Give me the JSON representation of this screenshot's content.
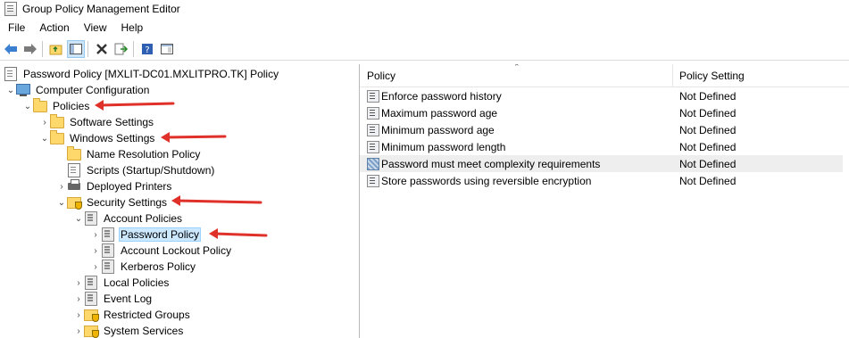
{
  "window": {
    "title": "Group Policy Management Editor"
  },
  "menu": [
    "File",
    "Action",
    "View",
    "Help"
  ],
  "toolbar": {
    "buttons": [
      "back-icon",
      "forward-icon",
      "up-folder-icon",
      "show-hide-tree-icon",
      "delete-icon",
      "export-list-icon",
      "help-icon",
      "properties-icon"
    ]
  },
  "tree": {
    "root": "Password Policy [MXLIT-DC01.MXLITPRO.TK] Policy",
    "computer_configuration": "Computer Configuration",
    "policies": "Policies",
    "software_settings": "Software Settings",
    "windows_settings": "Windows Settings",
    "name_resolution_policy": "Name Resolution Policy",
    "scripts": "Scripts (Startup/Shutdown)",
    "deployed_printers": "Deployed Printers",
    "security_settings": "Security Settings",
    "account_policies": "Account Policies",
    "password_policy": "Password Policy",
    "account_lockout_policy": "Account Lockout Policy",
    "kerberos_policy": "Kerberos Policy",
    "local_policies": "Local Policies",
    "event_log": "Event Log",
    "restricted_groups": "Restricted Groups",
    "system_services": "System Services"
  },
  "list": {
    "col_policy": "Policy",
    "col_setting": "Policy Setting",
    "rows": [
      {
        "name": "Enforce password history",
        "value": "Not Defined"
      },
      {
        "name": "Maximum password age",
        "value": "Not Defined"
      },
      {
        "name": "Minimum password age",
        "value": "Not Defined"
      },
      {
        "name": "Minimum password length",
        "value": "Not Defined"
      },
      {
        "name": "Password must meet complexity requirements",
        "value": "Not Defined"
      },
      {
        "name": "Store passwords using reversible encryption",
        "value": "Not Defined"
      }
    ]
  },
  "colors": {
    "annotation_arrow": "#e0302a",
    "selection": "#cce8ff"
  }
}
